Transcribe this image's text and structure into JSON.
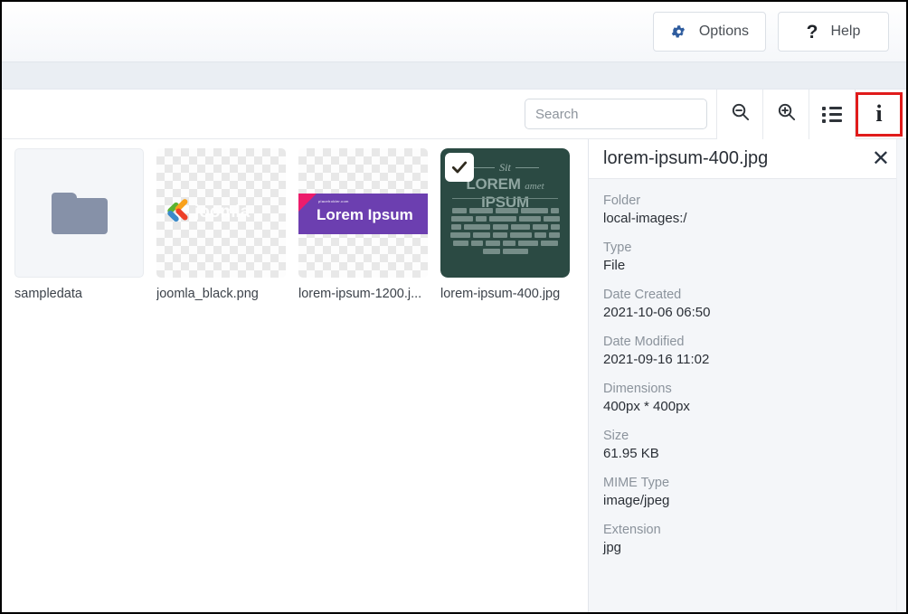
{
  "topbar": {
    "buttons": [
      {
        "label": "Options",
        "icon": "gear-icon"
      },
      {
        "label": "Help",
        "icon": "question-mark-icon"
      }
    ]
  },
  "toolbar": {
    "search": {
      "value": "",
      "placeholder": "Search"
    },
    "buttons": [
      {
        "name": "zoom-out-button",
        "icon": "magnifier-minus-icon"
      },
      {
        "name": "zoom-in-button",
        "icon": "magnifier-plus-icon"
      },
      {
        "name": "list-view-button",
        "icon": "list-view-icon"
      },
      {
        "name": "info-toggle-button",
        "icon": "info-icon",
        "highlighted": true
      }
    ],
    "highlight_color": "#e01b1b"
  },
  "browser": {
    "items": [
      {
        "label": "sampledata",
        "kind": "folder",
        "selected": false
      },
      {
        "label": "joomla_black.png",
        "kind": "image-transparent",
        "selected": false,
        "thumb_text": "joomla"
      },
      {
        "label": "lorem-ipsum-1200.j...",
        "kind": "image-transparent",
        "selected": false,
        "thumb_text": "Lorem Ipsum",
        "thumb_subtext": "placeholder.com"
      },
      {
        "label": "lorem-ipsum-400.jpg",
        "kind": "image",
        "selected": true,
        "thumb_sit": "Sit",
        "thumb_lorem": "LOREM",
        "thumb_amet": "amet",
        "thumb_ipsum": "IPSUM"
      }
    ]
  },
  "info_panel": {
    "title": "lorem-ipsum-400.jpg",
    "close_label": "✕",
    "fields": [
      {
        "key": "Folder",
        "value": "local-images:/"
      },
      {
        "key": "Type",
        "value": "File"
      },
      {
        "key": "Date Created",
        "value": "2021-10-06 06:50"
      },
      {
        "key": "Date Modified",
        "value": "2021-09-16 11:02"
      },
      {
        "key": "Dimensions",
        "value": "400px * 400px"
      },
      {
        "key": "Size",
        "value": "61.95 KB"
      },
      {
        "key": "MIME Type",
        "value": "image/jpeg"
      },
      {
        "key": "Extension",
        "value": "jpg"
      }
    ]
  }
}
